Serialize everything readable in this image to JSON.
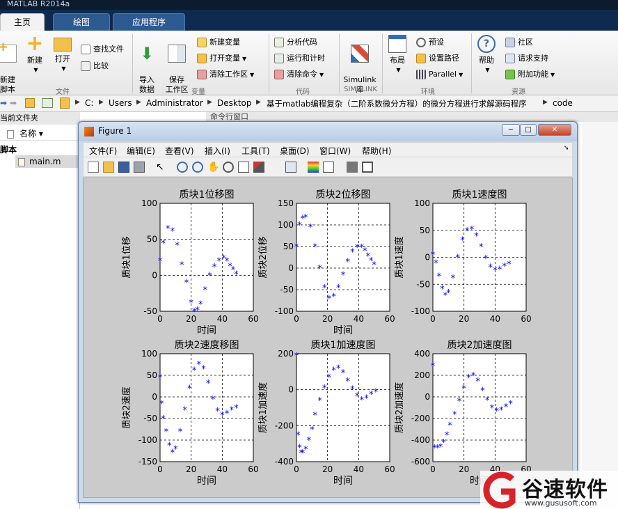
{
  "app": {
    "title": "MATLAB R2014a"
  },
  "tabs": [
    {
      "label": "主页"
    },
    {
      "label": "绘图"
    },
    {
      "label": "应用程序"
    }
  ],
  "ribbon": {
    "file": {
      "new_script": "新建\n脚本",
      "new": "新建",
      "open": "打开",
      "find_files": "查找文件",
      "compare": "比较",
      "group": "文件"
    },
    "variable": {
      "import": "导入\n数据",
      "save_ws": "保存\n工作区",
      "new_var": "新建变量",
      "open_var": "打开变量",
      "clear_ws": "清除工作区",
      "group": "变量"
    },
    "code": {
      "analyze": "分析代码",
      "run_time": "运行和计时",
      "clear_cmd": "清除命令",
      "group": "代码"
    },
    "simulink": {
      "label": "Simulink\n库",
      "group": "SIMULINK"
    },
    "env": {
      "layout": "布局",
      "prefs": "预设",
      "set_path": "设置路径",
      "parallel": "Parallel",
      "group": "环境"
    },
    "resources": {
      "help": "帮助",
      "community": "社区",
      "support": "请求支持",
      "addons": "附加功能",
      "group": "资源"
    }
  },
  "address": {
    "crumbs": [
      "C:",
      "Users",
      "Administrator",
      "Desktop",
      "基于matlab编程复杂（二阶系数微分方程）的微分方程进行求解源码程序",
      "code"
    ]
  },
  "left_panel": {
    "title": "当前文件夹",
    "col_name": "名称 ▾",
    "section": "脚本",
    "file": "main.m"
  },
  "command_window": {
    "title": "命令行窗口"
  },
  "figure": {
    "title": "Figure 1",
    "menus": [
      "文件(F)",
      "编辑(E)",
      "查看(V)",
      "插入(I)",
      "工具(T)",
      "桌面(D)",
      "窗口(W)",
      "帮助(H)"
    ],
    "toolbar_icons": [
      "new-figure-icon",
      "open-icon",
      "save-icon",
      "print-icon",
      "pointer-icon",
      "zoom-in-icon",
      "zoom-out-icon",
      "pan-icon",
      "rotate-icon",
      "data-cursor-icon",
      "brush-icon",
      "link-icon",
      "colorbar-icon",
      "legend-icon",
      "hide-tools-icon",
      "show-tools-icon"
    ]
  },
  "watermark": {
    "text": "谷速软件",
    "url": "www.gususoft.com"
  },
  "colors": {
    "marker": "#0000ff",
    "plot_bg": "#ffffff",
    "figure_bg": "#cbcbcb"
  },
  "chart_data": [
    {
      "type": "scatter",
      "title": "质块1位移图",
      "xlabel": "时间",
      "ylabel": "质块1位移",
      "xlim": [
        0,
        60
      ],
      "ylim": [
        -50,
        100
      ],
      "xticks": [
        0,
        20,
        40,
        60
      ],
      "yticks": [
        -50,
        0,
        50,
        100
      ],
      "grid": true,
      "marker": "*",
      "x": [
        0,
        2,
        5,
        8,
        11,
        14,
        17,
        20,
        22,
        24,
        26,
        29,
        32,
        35,
        38,
        41,
        43,
        45,
        47,
        49
      ],
      "y": [
        20,
        45,
        65,
        62,
        42,
        15,
        -10,
        -38,
        -50,
        -48,
        -40,
        -20,
        0,
        12,
        20,
        24,
        20,
        13,
        8,
        2
      ]
    },
    {
      "type": "scatter",
      "title": "质块2位移图",
      "xlabel": "时间",
      "ylabel": "质块2位移",
      "xlim": [
        0,
        60
      ],
      "ylim": [
        -100,
        150
      ],
      "xticks": [
        0,
        20,
        40,
        60
      ],
      "yticks": [
        -100,
        -50,
        0,
        50,
        100,
        150
      ],
      "grid": true,
      "marker": "*",
      "x": [
        0,
        2,
        4,
        6,
        9,
        12,
        15,
        18,
        21,
        24,
        27,
        30,
        33,
        36,
        39,
        42,
        44,
        46,
        48,
        50
      ],
      "y": [
        50,
        100,
        115,
        118,
        95,
        50,
        0,
        -45,
        -70,
        -65,
        -45,
        -15,
        15,
        38,
        48,
        48,
        40,
        28,
        18,
        8
      ]
    },
    {
      "type": "scatter",
      "title": "质块1速度图",
      "xlabel": "",
      "ylabel": "质块1速度",
      "xlim": [
        0,
        60
      ],
      "ylim": [
        -100,
        100
      ],
      "xticks": [
        0,
        20,
        40,
        60
      ],
      "yticks": [
        -100,
        -50,
        0,
        50,
        100
      ],
      "grid": true,
      "marker": "*",
      "x": [
        0,
        2,
        4,
        6,
        8,
        10,
        13,
        16,
        19,
        22,
        25,
        28,
        31,
        34,
        37,
        40,
        43,
        46,
        49
      ],
      "y": [
        5,
        -10,
        -35,
        -58,
        -70,
        -65,
        -38,
        0,
        32,
        50,
        52,
        40,
        20,
        -2,
        -18,
        -24,
        -22,
        -16,
        -12
      ]
    },
    {
      "type": "scatter",
      "title": "质块2速度移图",
      "xlabel": "时间",
      "ylabel": "质块2速度",
      "xlim": [
        0,
        60
      ],
      "ylim": [
        -150,
        100
      ],
      "xticks": [
        0,
        20,
        40,
        60
      ],
      "yticks": [
        -150,
        -100,
        -50,
        0,
        50,
        100
      ],
      "grid": true,
      "marker": "*",
      "x": [
        0,
        1,
        2,
        4,
        6,
        8,
        10,
        13,
        16,
        19,
        22,
        25,
        28,
        31,
        34,
        37,
        40,
        43,
        46,
        49
      ],
      "y": [
        45,
        -15,
        -50,
        -80,
        -112,
        -128,
        -120,
        -80,
        -30,
        20,
        62,
        76,
        65,
        32,
        -5,
        -32,
        -42,
        -38,
        -30,
        -25
      ]
    },
    {
      "type": "scatter",
      "title": "质块1加速度图",
      "xlabel": "时间",
      "ylabel": "质块1加速度",
      "xlim": [
        0,
        60
      ],
      "ylim": [
        -400,
        200
      ],
      "xticks": [
        0,
        20,
        40,
        60
      ],
      "yticks": [
        -400,
        -200,
        0,
        200
      ],
      "grid": true,
      "marker": "*",
      "x": [
        0,
        1,
        2,
        3,
        4,
        6,
        8,
        10,
        12,
        15,
        18,
        21,
        24,
        27,
        30,
        33,
        36,
        39,
        42,
        45,
        48,
        51
      ],
      "y": [
        190,
        -250,
        -320,
        -350,
        -350,
        -330,
        -280,
        -220,
        -140,
        -60,
        10,
        70,
        110,
        120,
        95,
        50,
        5,
        -35,
        -55,
        -45,
        -25,
        -10
      ]
    },
    {
      "type": "scatter",
      "title": "质块2加速度图",
      "xlabel": "时间",
      "ylabel": "质块2加速度",
      "xlim": [
        0,
        60
      ],
      "ylim": [
        -600,
        400
      ],
      "xticks": [
        0,
        20,
        40,
        60
      ],
      "yticks": [
        -600,
        -400,
        -200,
        0,
        200,
        400
      ],
      "grid": true,
      "marker": "*",
      "x": [
        0,
        1,
        3,
        5,
        7,
        9,
        11,
        14,
        17,
        20,
        23,
        26,
        29,
        32,
        35,
        38,
        41,
        44,
        47,
        50
      ],
      "y": [
        290,
        -470,
        -470,
        -460,
        -420,
        -350,
        -260,
        -160,
        -40,
        80,
        180,
        200,
        150,
        60,
        -30,
        -100,
        -130,
        -120,
        -90,
        -60
      ]
    }
  ]
}
